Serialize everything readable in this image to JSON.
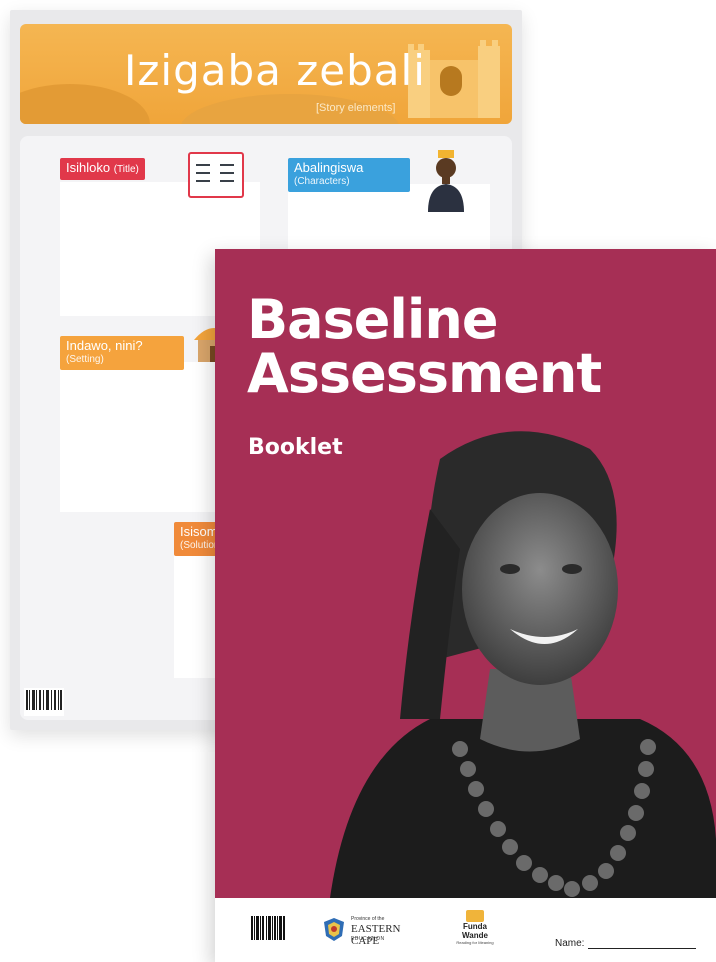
{
  "poster": {
    "title": "Izigaba zebali",
    "subtitle": "[Story elements]",
    "sections": [
      {
        "label": "Isihloko",
        "sub": "(Title)"
      },
      {
        "label": "Abalingiswa",
        "sub": "(Characters)"
      },
      {
        "label": "Indawo, nini?",
        "sub": "(Setting)"
      },
      {
        "label": "Isisom",
        "sub": "(Solution"
      }
    ]
  },
  "booklet": {
    "title_line1": "Baseline",
    "title_line2": "Assessment",
    "subtitle": "Booklet",
    "colors": {
      "background": "#a62f55"
    },
    "footer": {
      "ec_small": "Province of the",
      "ec_main": "EASTERN CAPE",
      "ec_edu": "EDUCATION",
      "fw_line1": "Funda",
      "fw_line2": "Wande",
      "fw_tagline": "Reading for Meaning",
      "name_label": "Name:"
    }
  }
}
